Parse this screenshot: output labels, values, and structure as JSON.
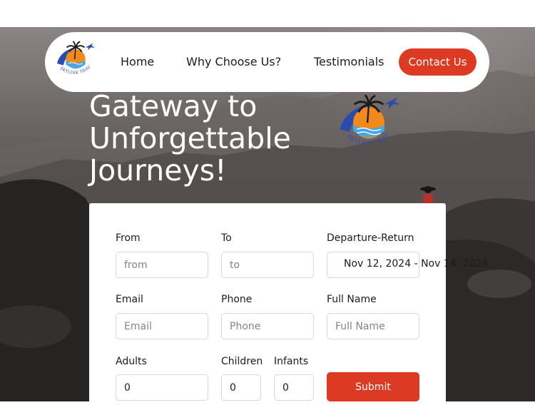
{
  "nav": {
    "logo_text": "SKYLINK TRAVELS",
    "links": [
      "Home",
      "Why Choose Us?",
      "Testimonials"
    ],
    "contact_label": "Contact Us"
  },
  "hero": {
    "title_lines": [
      "Gateway to",
      "Unforgettable",
      "Journeys!"
    ],
    "logo_text": "SKYLINK TRAVELS"
  },
  "form": {
    "from": {
      "label": "From",
      "placeholder": "from"
    },
    "to": {
      "label": "To",
      "placeholder": "to"
    },
    "dates": {
      "label": "Departure-Return",
      "value": "Nov 12, 2024 - Nov 14, 2024"
    },
    "email": {
      "label": "Email",
      "placeholder": "Email"
    },
    "phone": {
      "label": "Phone",
      "placeholder": "Phone"
    },
    "fullname": {
      "label": "Full Name",
      "placeholder": "Full Name"
    },
    "adults": {
      "label": "Adults",
      "value": "0"
    },
    "children": {
      "label": "Children",
      "value": "0"
    },
    "infants": {
      "label": "Infants",
      "value": "0"
    },
    "submit_label": "Submit"
  },
  "colors": {
    "accent": "#dc3a22",
    "logo_blue": "#2a4bb0",
    "logo_orange": "#f08a1c",
    "logo_sky": "#43a7e8"
  }
}
